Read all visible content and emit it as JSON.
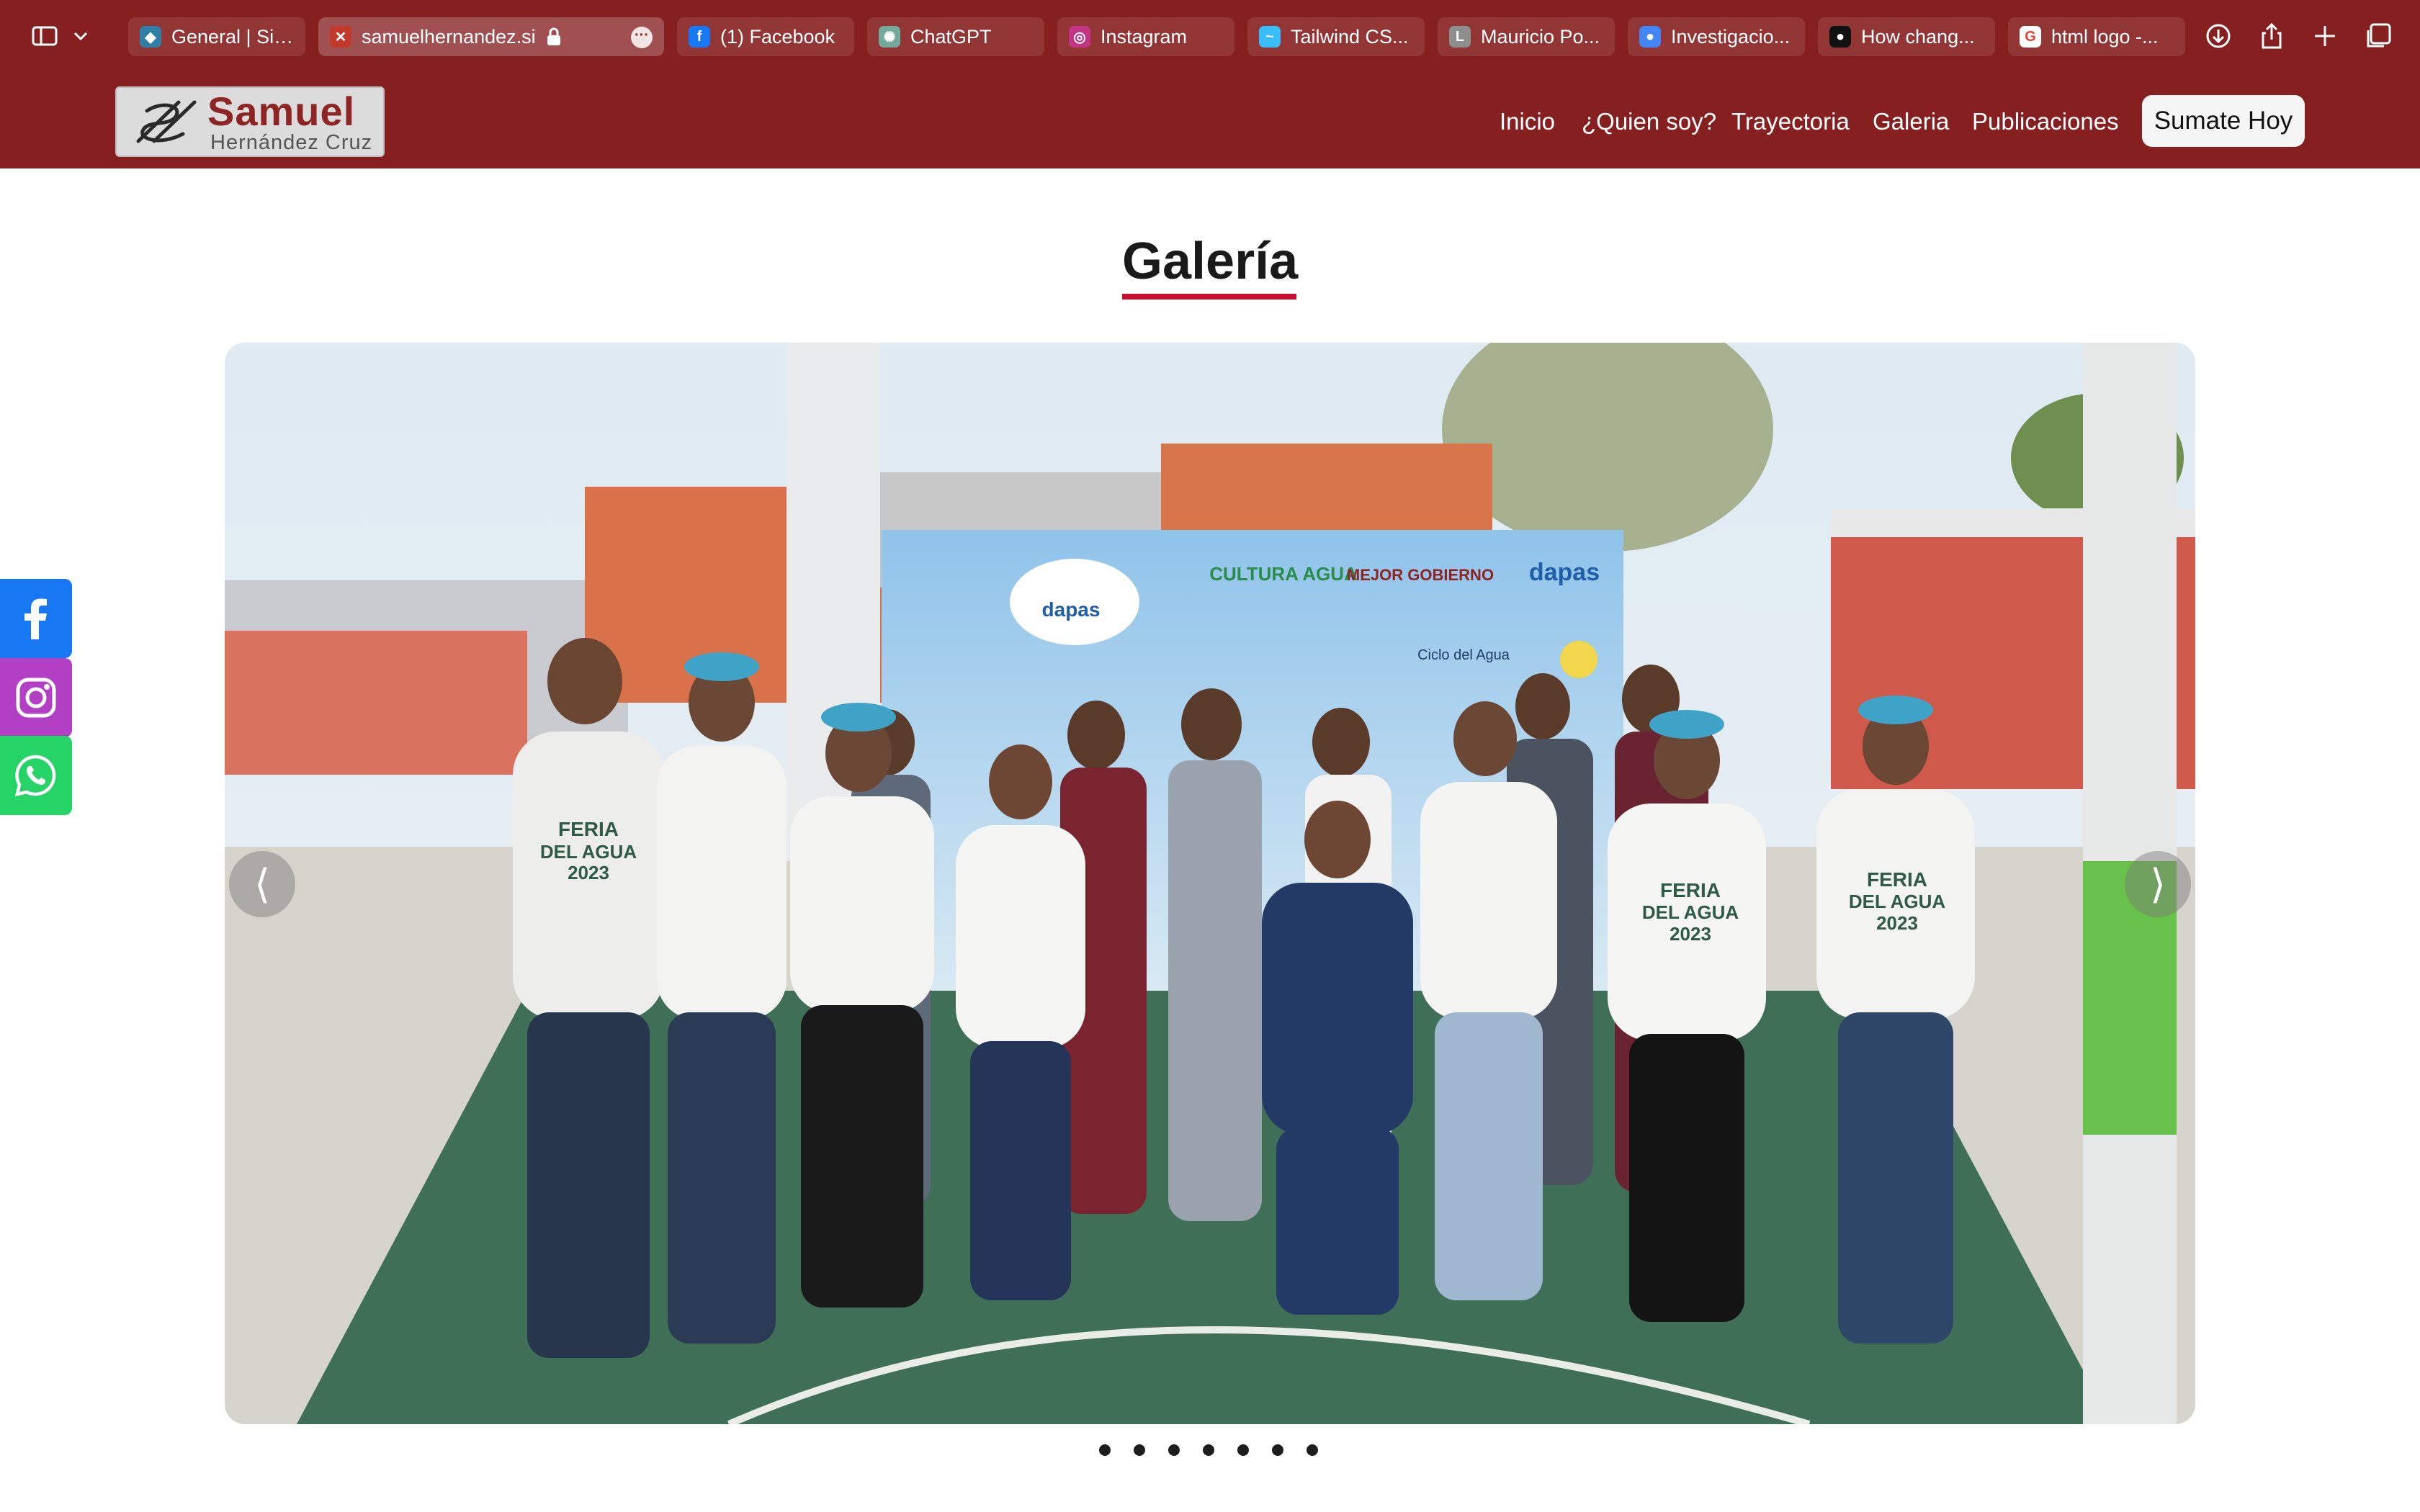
{
  "browser": {
    "tabs": [
      {
        "label": "General | Sit...",
        "icon": "diamond-icon",
        "color": "#2f7ea6"
      },
      {
        "label": "samuelhernandez.si",
        "icon": "site-favicon-icon",
        "color": "#c0392b",
        "active": true
      },
      {
        "label": "(1) Facebook",
        "icon": "facebook-icon",
        "color": "#1877f2"
      },
      {
        "label": "ChatGPT",
        "icon": "chatgpt-icon",
        "color": "#74aa9c"
      },
      {
        "label": "Instagram",
        "icon": "instagram-icon",
        "color": "#c13584"
      },
      {
        "label": "Tailwind CS...",
        "icon": "tailwind-icon",
        "color": "#38bdf8"
      },
      {
        "label": "Mauricio Po...",
        "icon": "letter-l-icon",
        "color": "#8e8e8e"
      },
      {
        "label": "Investigacio...",
        "icon": "circle-icon",
        "color": "#4285f4"
      },
      {
        "label": "How chang...",
        "icon": "github-icon",
        "color": "#111111"
      },
      {
        "label": "html logo -...",
        "icon": "google-icon",
        "color": "#ea4335"
      }
    ]
  },
  "header": {
    "logo": {
      "name": "Samuel",
      "subtitle": "Hernández Cruz"
    },
    "nav": [
      "Inicio",
      "¿Quien soy?",
      "Trayectoria",
      "Galeria",
      "Publicaciones"
    ],
    "cta_label": "Sumate Hoy"
  },
  "gallery": {
    "title": "Galería",
    "prev_label": "⟨",
    "next_label": "⟩",
    "slide_count": 7,
    "active_slide": 1,
    "photo_text": {
      "brand": "dapas",
      "shirt_line1": "FERIA",
      "shirt_line2": "DEL AGUA",
      "shirt_year": "2023",
      "banner_logo1": "CULTURA AGUA",
      "banner_logo2": "MEJOR GOBIERNO",
      "banner_caption": "Ciclo del Agua"
    }
  },
  "social": [
    {
      "name": "facebook",
      "icon": "facebook-icon",
      "color": "#1877f2"
    },
    {
      "name": "instagram",
      "icon": "instagram-icon",
      "color": "#b23fc4"
    },
    {
      "name": "whatsapp",
      "icon": "whatsapp-icon",
      "color": "#25d366"
    }
  ],
  "colors": {
    "brand": "#861f1f",
    "accent": "#c8102e"
  }
}
